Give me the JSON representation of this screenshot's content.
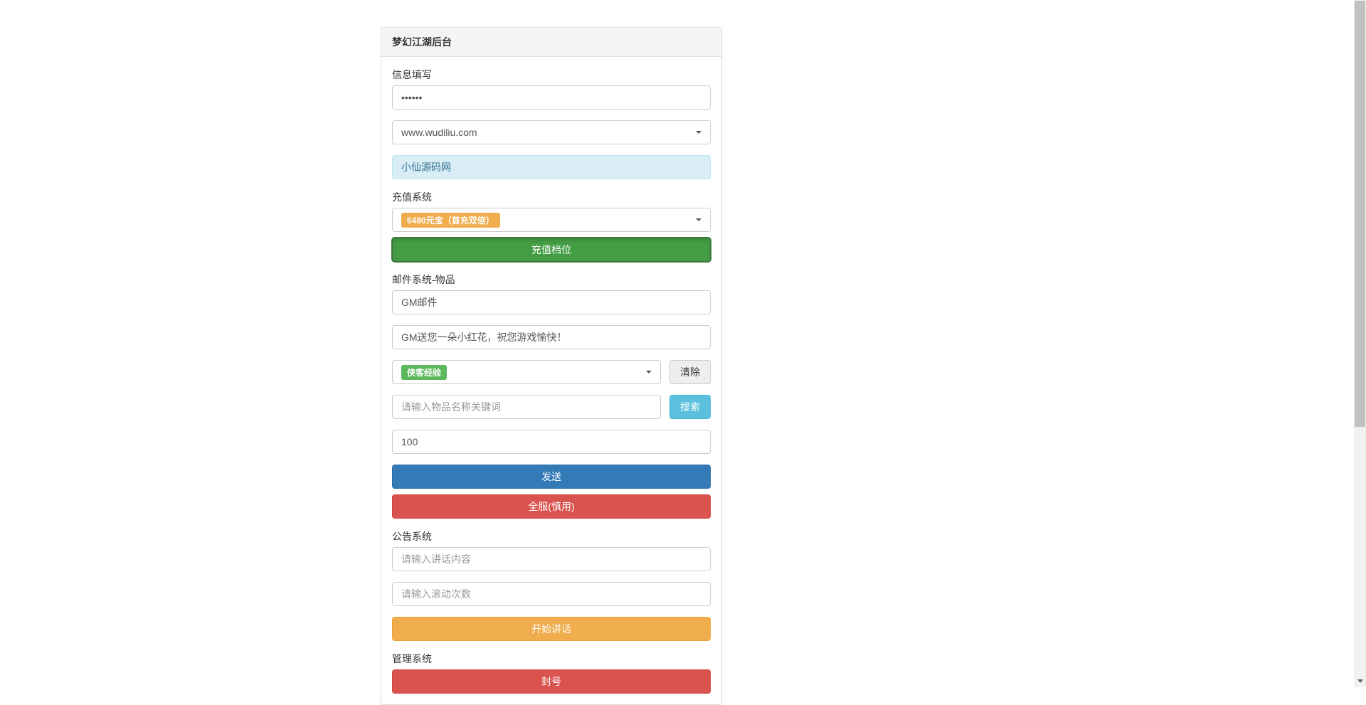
{
  "panel": {
    "title": "梦幻江湖后台"
  },
  "info": {
    "label": "信息填写",
    "password_value": "••••••",
    "server_value": "www.wudiliu.com",
    "account_value": "小仙源码网"
  },
  "recharge": {
    "label": "充值系统",
    "tier_value": "6480元宝（首充双倍）",
    "button": "充值档位"
  },
  "mail": {
    "label": "邮件系统-物品",
    "title_value": "GM邮件",
    "content_value": "GM送您一朵小红花，祝您游戏愉快！",
    "item_value": "侠客经验",
    "clear_button": "清除",
    "search_placeholder": "请输入物品名称关键词",
    "search_button": "搜索",
    "quantity_value": "100",
    "send_button": "发送",
    "allserver_button": "全服(慎用)"
  },
  "notice": {
    "label": "公告系统",
    "content_placeholder": "请输入讲话内容",
    "times_placeholder": "请输入滚动次数",
    "start_button": "开始讲话"
  },
  "manage": {
    "label": "管理系统",
    "ban_button": "封号"
  }
}
